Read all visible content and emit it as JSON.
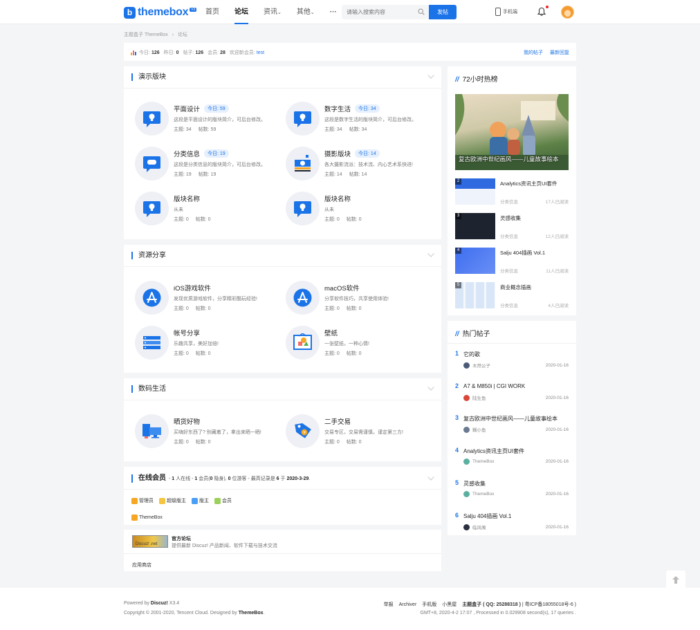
{
  "header": {
    "logo_text": "themebox",
    "logo_badge": "V3",
    "nav": [
      {
        "label": "首页",
        "active": false
      },
      {
        "label": "论坛",
        "active": true
      },
      {
        "label": "资讯",
        "active": false,
        "dropdown": true
      },
      {
        "label": "其他",
        "active": false,
        "dropdown": true
      },
      {
        "label": "···",
        "active": false
      }
    ],
    "search_placeholder": "请输入搜索内容",
    "post_label": "发帖",
    "mobile_label": "手机端"
  },
  "breadcrumb": {
    "home": "主题盒子 ThemeBox",
    "sep": "›",
    "current": "论坛"
  },
  "stats": {
    "today_label": "今日:",
    "today": "126",
    "yesterday_label": "昨日:",
    "yesterday": "0",
    "posts_label": "帖子:",
    "posts": "126",
    "members_label": "会员:",
    "members": "28",
    "welcome_label": "欢迎新会员:",
    "new_member": "test",
    "my_posts": "我的帖子",
    "latest_replies": "最新回复"
  },
  "sections": [
    {
      "title": "演示版块",
      "forums": [
        {
          "name": "平面设计",
          "today": "今日: 59",
          "desc": "这段是平面设计的版块简介，可后台修改。",
          "topics": "主题: 34",
          "posts": "帖数: 59",
          "icon": "bulb-icon"
        },
        {
          "name": "数字生活",
          "today": "今日: 34",
          "desc": "这段是数字生活的版块简介，可后台修改。",
          "topics": "主题: 34",
          "posts": "帖数: 34",
          "icon": "bulb-icon"
        },
        {
          "name": "分类信息",
          "today": "今日: 19",
          "desc": "这段是分类信息的版块简介，可后台修改。",
          "topics": "主题: 19",
          "posts": "帖数: 19",
          "icon": "chat-icon"
        },
        {
          "name": "摄影版块",
          "today": "今日: 14",
          "desc": "各大摄影流派：技术流、内心艺术系快进!",
          "topics": "主题: 14",
          "posts": "帖数: 14",
          "icon": "camera-icon"
        },
        {
          "name": "版块名称",
          "today": "",
          "desc": "从未",
          "topics": "主题: 0",
          "posts": "帖数: 0",
          "icon": "bulb-icon"
        },
        {
          "name": "版块名称",
          "today": "",
          "desc": "从未",
          "topics": "主题: 0",
          "posts": "帖数: 0",
          "icon": "bulb-icon"
        }
      ]
    },
    {
      "title": "资源分享",
      "forums": [
        {
          "name": "iOS游戏软件",
          "today": "",
          "desc": "发现优质游戏软件，分享精彩酷玩经验!",
          "topics": "主题: 0",
          "posts": "帖数: 0",
          "icon": "appstore-icon"
        },
        {
          "name": "macOS软件",
          "today": "",
          "desc": "分享软件技巧，共享使用体验!",
          "topics": "主题: 0",
          "posts": "帖数: 0",
          "icon": "appstore-icon"
        },
        {
          "name": "帐号分享",
          "today": "",
          "desc": "乐趣共享，美好加倍!",
          "topics": "主题: 0",
          "posts": "帖数: 0",
          "icon": "server-icon"
        },
        {
          "name": "壁纸",
          "today": "",
          "desc": "一张壁纸，一种心情!",
          "topics": "主题: 0",
          "posts": "帖数: 0",
          "icon": "wallpaper-icon"
        }
      ]
    },
    {
      "title": "数码生活",
      "forums": [
        {
          "name": "晒货好物",
          "today": "",
          "desc": "买嗨好东西了? 别藏着了，拿出来晒一晒!",
          "topics": "主题: 0",
          "posts": "帖数: 0",
          "icon": "devices-icon"
        },
        {
          "name": "二手交易",
          "today": "",
          "desc": "交易专区，交易需谨慎，谨定第三方!",
          "topics": "主题: 0",
          "posts": "帖数: 0",
          "icon": "tag-icon"
        }
      ]
    }
  ],
  "online": {
    "title": "在线会员",
    "summary_a": "- ",
    "online_count": "1",
    "summary_b": " 人在线 - ",
    "member_count": "1",
    "summary_c": " 会员(",
    "hidden_count": "0",
    "summary_d": " 隐身), ",
    "guest_count": "0",
    "summary_e": " 位游客 - 最高记录是 ",
    "record": "6",
    "summary_f": " 于 ",
    "record_date": "2020-3-29",
    "summary_g": ".",
    "legend": [
      {
        "label": "管理员",
        "color": "#f5a623"
      },
      {
        "label": "超级版主",
        "color": "#f5c542"
      },
      {
        "label": "版主",
        "color": "#4a9ff5"
      },
      {
        "label": "会员",
        "color": "#9bd15a"
      }
    ],
    "member": "ThemeBox"
  },
  "friend": {
    "logo_text": "Discuz! .net",
    "name": "官方论坛",
    "desc": "提供最新 Discuz! 产品新闻、软件下载与技术交流",
    "app_store": "应用商店"
  },
  "sidebar": {
    "hot72": {
      "title": "72小时热榜",
      "slashes": "//",
      "hero_caption": "复古欧洲中世纪画风——儿童故事绘本",
      "items": [
        {
          "num": "2",
          "title": "Analytics资讯主页UI套件",
          "cat": "分类信息",
          "reads": "17人已阅读",
          "thumb": "#2f6ae0"
        },
        {
          "num": "3",
          "title": "灵感收集",
          "cat": "分类信息",
          "reads": "12人已阅读",
          "thumb": "#1d2430"
        },
        {
          "num": "4",
          "title": "Salju 404插画 Vol.1",
          "cat": "分类信息",
          "reads": "11人已阅读",
          "thumb": "#3d6ef0"
        },
        {
          "num": "5",
          "title": "商业概念插画",
          "cat": "分类信息",
          "reads": "4人已阅读",
          "thumb": "#d8e6f8"
        }
      ]
    },
    "hot_posts": {
      "title": "热门帖子",
      "slashes": "//",
      "items": [
        {
          "num": "1",
          "title": "它的歌",
          "author": "木然公子",
          "date": "2020-01-16",
          "avatar": "#4a5a78"
        },
        {
          "num": "2",
          "title": "A7 & M850i | CGI WORK",
          "author": "陆生鱼",
          "date": "2020-01-16",
          "avatar": "#d8483a"
        },
        {
          "num": "3",
          "title": "复古欧洲中世纪画风——儿童故事绘本",
          "author": "糊小鱼",
          "date": "2020-01-16",
          "avatar": "#6a7a90"
        },
        {
          "num": "4",
          "title": "Analytics资讯主页UI套件",
          "author": "ThemeBox",
          "date": "2020-01-16",
          "avatar": "#5ab0a0"
        },
        {
          "num": "5",
          "title": "灵感收集",
          "author": "ThemeBox",
          "date": "2020-01-16",
          "avatar": "#5ab0a0"
        },
        {
          "num": "6",
          "title": "Salju 404插画 Vol.1",
          "author": "临风阁",
          "date": "2020-01-16",
          "avatar": "#2a3040"
        }
      ]
    }
  },
  "footer": {
    "powered_prefix": "Powered by ",
    "powered_name": "Discuz!",
    "powered_ver": " X3.4",
    "copyright_a": "Copyright © 2001-2020, Tencent Cloud.   Designed by ",
    "copyright_b": "ThemeBox",
    "copyright_c": ".",
    "links": [
      "举报",
      "Archiver",
      "手机版",
      "小黑屋"
    ],
    "site_name": "主题盒子 ( QQ: 25288318 )",
    "icp": " | 粤ICP备18055018号-6 )",
    "gmt": "GMT+8, 2020-4-2 17:07 , Processed in 0.029908 second(s), 17 queries ."
  },
  "colors": {
    "accent": "#1b73e8",
    "background": "#f4f5f7"
  }
}
